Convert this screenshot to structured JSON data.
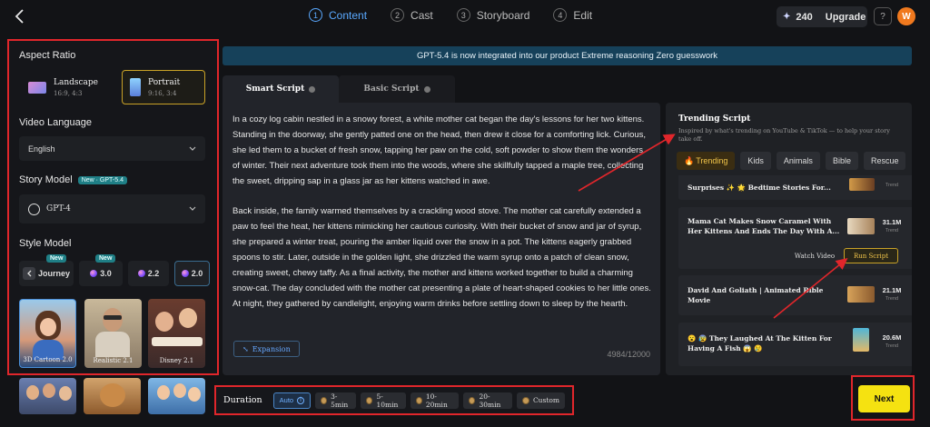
{
  "steps": [
    {
      "num": "1",
      "label": "Content"
    },
    {
      "num": "2",
      "label": "Cast"
    },
    {
      "num": "3",
      "label": "Storyboard"
    },
    {
      "num": "4",
      "label": "Edit"
    }
  ],
  "header": {
    "credits": "240",
    "upgrade": "Upgrade",
    "avatar_letter": "W"
  },
  "left": {
    "aspect_ratio_label": "Aspect Ratio",
    "landscape": {
      "title": "Landscape",
      "ratios": "16:9, 4:3"
    },
    "portrait": {
      "title": "Portrait",
      "ratios": "9:16, 3:4"
    },
    "video_language_label": "Video Language",
    "video_language_value": "English",
    "story_model_label": "Story Model",
    "story_model_badge": "New · GPT-5.4",
    "story_model_value": "GPT-4",
    "style_model_label": "Style Model",
    "style_chips": [
      {
        "label": "Journey",
        "new": "New"
      },
      {
        "label": "3.0",
        "new": "New"
      },
      {
        "label": "2.2",
        "new": ""
      },
      {
        "label": "2.0",
        "new": ""
      }
    ],
    "thumbs": [
      {
        "caption": "3D Cartoon 2.0"
      },
      {
        "caption": "Realistic 2.1"
      },
      {
        "caption": "Disney 2.1"
      }
    ]
  },
  "banner": "GPT-5.4 is now integrated into our product Extreme reasoning Zero guesswork",
  "script": {
    "tab_smart": "Smart Script",
    "tab_basic": "Basic Script",
    "para1": "In a cozy log cabin nestled in a snowy forest, a white mother cat began the day's lessons for her two kittens. Standing in the doorway, she gently patted one on the head, then drew it close for a comforting lick. Curious, she led them to a bucket of fresh snow, tapping her paw on the cold, soft powder to show them the wonders of winter. Their next adventure took them into the woods, where she skillfully tapped a maple tree, collecting the sweet, dripping sap in a glass jar as her kittens watched in awe.",
    "para2": "Back inside, the family warmed themselves by a crackling wood stove. The mother cat carefully extended a paw to feel the heat, her kittens mimicking her cautious curiosity. With their bucket of snow and jar of syrup, she prepared a winter treat, pouring the amber liquid over the snow in a pot. The kittens eagerly grabbed spoons to stir. Later, outside in the golden light, she drizzled the warm syrup onto a patch of clean snow, creating sweet, chewy taffy. As a final activity, the mother and kittens worked together to build a charming snow-cat. The day concluded with the mother cat presenting a plate of heart-shaped cookies to her little ones. At night, they gathered by candlelight, enjoying warm drinks before settling down to sleep by the hearth.",
    "expansion": "Expansion",
    "count": "4984/12000"
  },
  "trending": {
    "title": "Trending Script",
    "subtitle": "Inspired by what's trending on YouTube & TikTok — to help your story take off.",
    "pills": [
      "Trending",
      "Kids",
      "Animals",
      "Bible",
      "Rescue"
    ],
    "items": [
      {
        "title": "Surprises ✨ 🌟 Bedtime Stories For...",
        "views": "",
        "label": "Trend"
      },
      {
        "title": "Mama Cat Makes Snow Caramel With Her Kittens And Ends The Day With A...",
        "views": "31.1M",
        "label": "Trend"
      },
      {
        "title": "David And Goliath | Animated Bible Movie",
        "views": "21.1M",
        "label": "Trend"
      },
      {
        "title": "😮 😰 They Laughed At The Kitten For Having A Fish 😱 😢",
        "views": "20.6M",
        "label": "Trend"
      }
    ],
    "watch_video": "Watch Video",
    "run_script": "Run Script"
  },
  "duration": {
    "label": "Duration",
    "options": [
      "Auto",
      "3-5min",
      "5-10min",
      "10-20min",
      "20-30min",
      "Custom"
    ]
  },
  "next": "Next"
}
